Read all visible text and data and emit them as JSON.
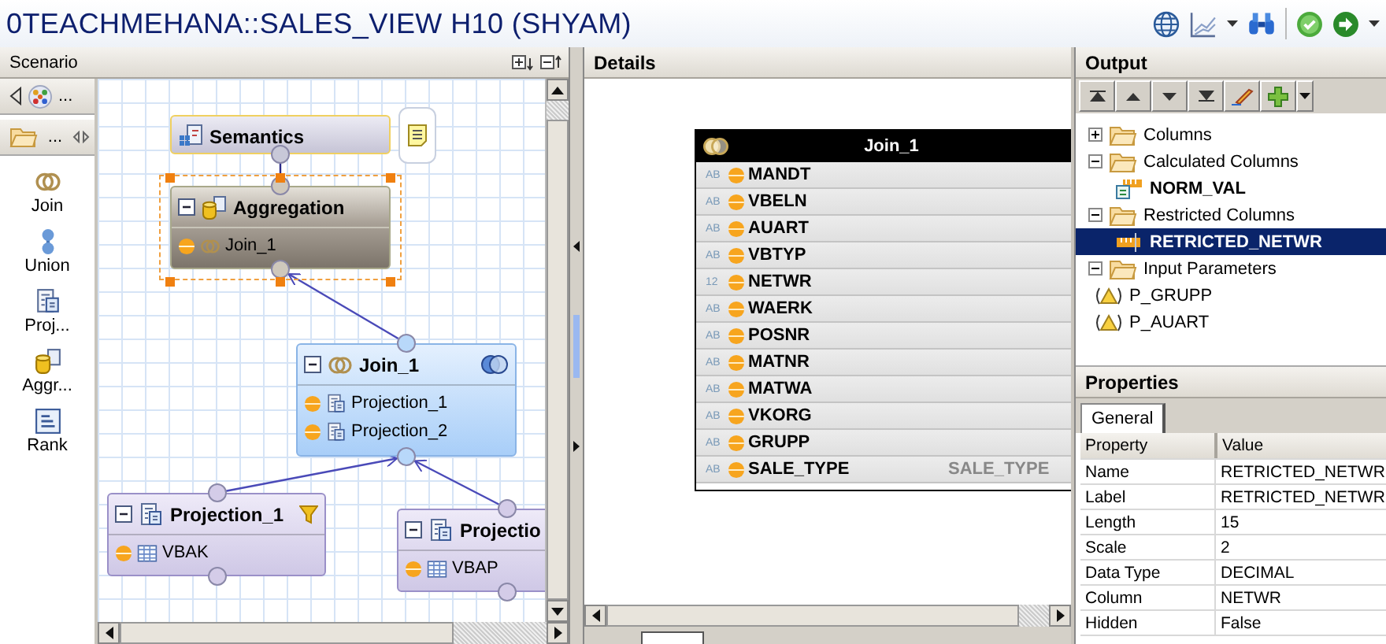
{
  "window": {
    "title": "0TEACHMEHANA::SALES_VIEW H10 (SHYAM)"
  },
  "scenario": {
    "title": "Scenario",
    "palette": {
      "header_more": "...",
      "folder_more": "...",
      "items": [
        {
          "label": "Join",
          "kind": "join"
        },
        {
          "label": "Union",
          "kind": "union"
        },
        {
          "label": "Proj...",
          "kind": "projection"
        },
        {
          "label": "Aggr...",
          "kind": "aggregation"
        },
        {
          "label": "Rank",
          "kind": "rank"
        }
      ]
    },
    "nodes": [
      {
        "kind": "semantics",
        "title": "Semantics",
        "selected": false,
        "filtered": false
      },
      {
        "kind": "aggregation",
        "title": "Aggregation",
        "selected": true,
        "filtered": false,
        "rows": [
          {
            "kind": "join",
            "label": "Join_1"
          }
        ]
      },
      {
        "kind": "join",
        "title": "Join_1",
        "selected": false,
        "filtered": false,
        "rows": [
          {
            "kind": "projection",
            "label": "Projection_1"
          },
          {
            "kind": "projection",
            "label": "Projection_2"
          }
        ]
      },
      {
        "kind": "projection",
        "title": "Projection_1",
        "selected": false,
        "filtered": true,
        "rows": [
          {
            "kind": "table",
            "label": "VBAK"
          }
        ]
      },
      {
        "kind": "projection",
        "title": "Projectio",
        "rows": [
          {
            "kind": "table",
            "label": "VBAP"
          }
        ]
      }
    ]
  },
  "details": {
    "title": "Details",
    "table": {
      "title": "Join_1",
      "columns": [
        {
          "type": "AB",
          "name": "MANDT"
        },
        {
          "type": "AB",
          "name": "VBELN"
        },
        {
          "type": "AB",
          "name": "AUART"
        },
        {
          "type": "AB",
          "name": "VBTYP"
        },
        {
          "type": "12",
          "name": "NETWR"
        },
        {
          "type": "AB",
          "name": "WAERK"
        },
        {
          "type": "AB",
          "name": "POSNR"
        },
        {
          "type": "AB",
          "name": "MATNR"
        },
        {
          "type": "AB",
          "name": "MATWA"
        },
        {
          "type": "AB",
          "name": "VKORG"
        },
        {
          "type": "AB",
          "name": "GRUPP"
        },
        {
          "type": "AB",
          "name": "SALE_TYPE",
          "mapping": "SALE_TYPE"
        }
      ]
    }
  },
  "output": {
    "title": "Output",
    "tree": [
      {
        "label": "Columns",
        "expanded": false,
        "selected": false
      },
      {
        "label": "Calculated Columns",
        "expanded": true,
        "selected": false,
        "children": [
          {
            "label": "NORM_VAL",
            "kind": "calculated",
            "selected": false
          }
        ]
      },
      {
        "label": "Restricted Columns",
        "expanded": true,
        "selected": false,
        "children": [
          {
            "label": "RETRICTED_NETWR",
            "kind": "restricted",
            "selected": true
          }
        ]
      },
      {
        "label": "Input Parameters",
        "expanded": true,
        "selected": false,
        "children": [
          {
            "label": "P_GRUPP",
            "kind": "parameter",
            "selected": false
          },
          {
            "label": "P_AUART",
            "kind": "parameter",
            "selected": false
          }
        ]
      }
    ]
  },
  "properties": {
    "title": "Properties",
    "tabs": [
      {
        "label": "General",
        "selected": true
      }
    ],
    "columns": [
      "Property",
      "Value"
    ],
    "rows": [
      {
        "property": "Name",
        "value": "RETRICTED_NETWR"
      },
      {
        "property": "Label",
        "value": "RETRICTED_NETWR"
      },
      {
        "property": "Length",
        "value": "15"
      },
      {
        "property": "Scale",
        "value": "2"
      },
      {
        "property": "Data Type",
        "value": "DECIMAL"
      },
      {
        "property": "Column",
        "value": "NETWR"
      },
      {
        "property": "Hidden",
        "value": "False"
      }
    ]
  }
}
